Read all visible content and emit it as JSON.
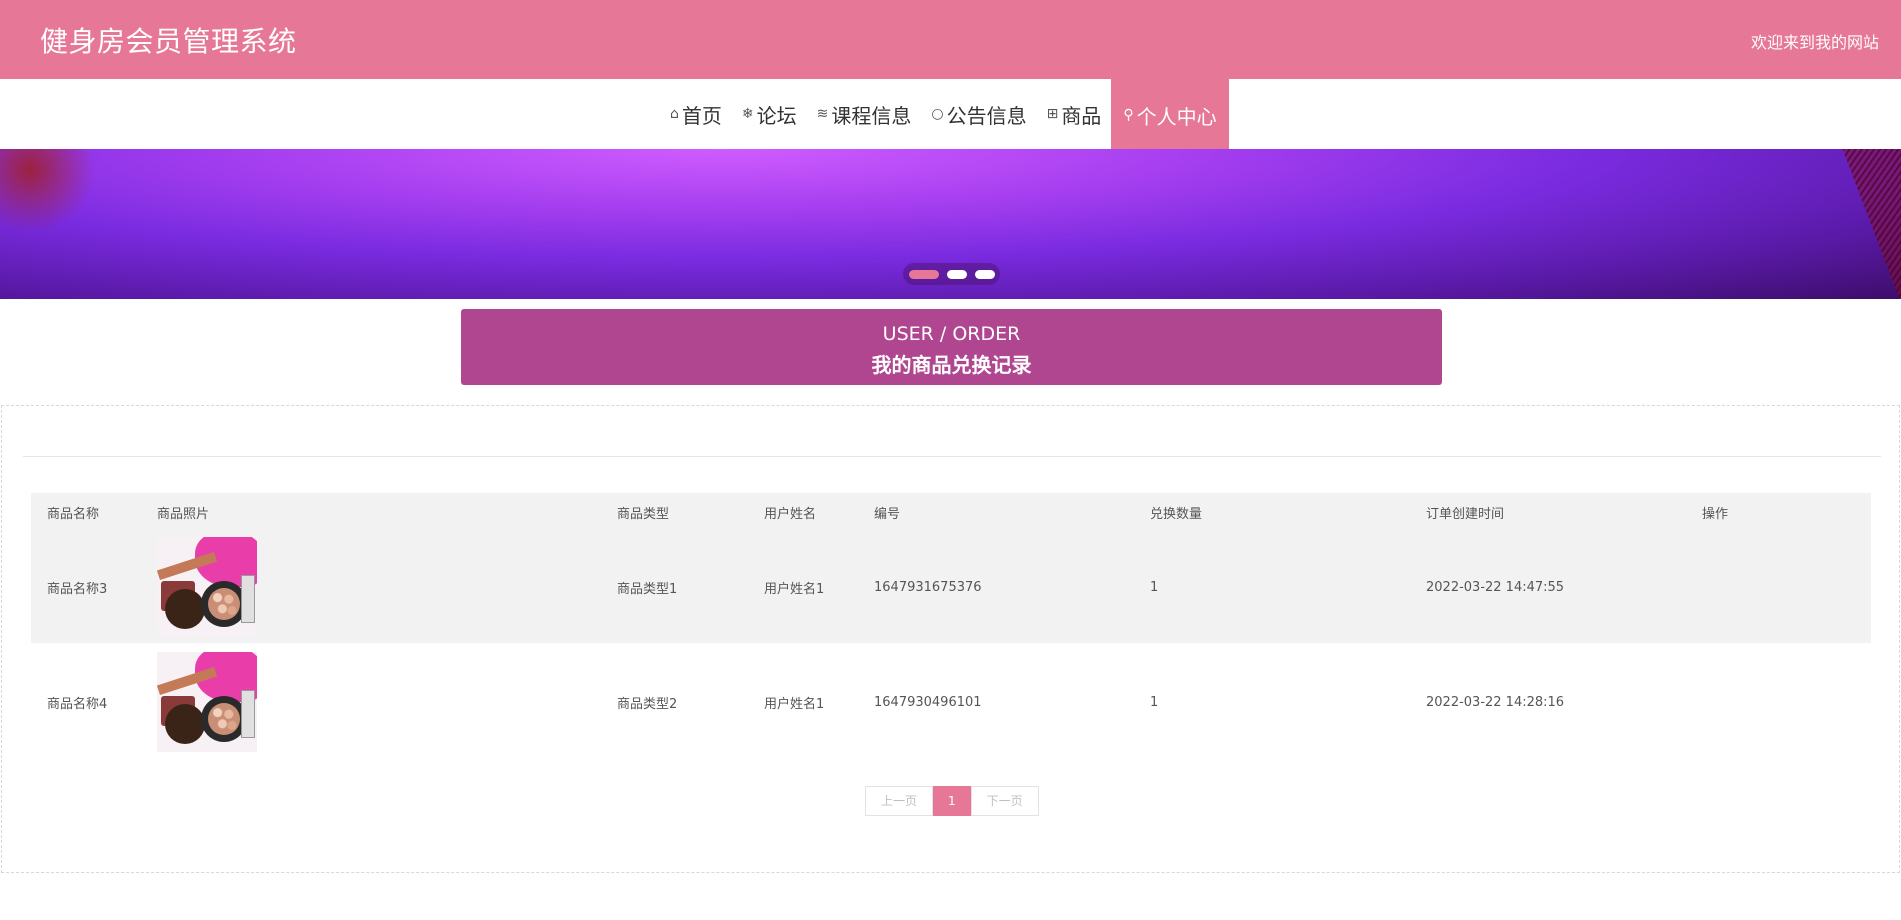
{
  "header": {
    "title": "健身房会员管理系统",
    "welcome": "欢迎来到我的网站"
  },
  "nav": {
    "items": [
      {
        "icon": "home-icon",
        "glyph": "⌂",
        "label": "首页"
      },
      {
        "icon": "snowflake-icon",
        "glyph": "❄",
        "label": "论坛"
      },
      {
        "icon": "layers-icon",
        "glyph": "≋",
        "label": "课程信息"
      },
      {
        "icon": "bubble-icon",
        "glyph": "○",
        "label": "公告信息"
      },
      {
        "icon": "gift-icon",
        "glyph": "⊞",
        "label": "商品"
      },
      {
        "icon": "user-icon",
        "glyph": "⚲",
        "label": "个人中心"
      }
    ],
    "active": "个人中心"
  },
  "banner": {
    "dots": 3,
    "active_dot": 1
  },
  "section": {
    "title_en": "USER / ORDER",
    "title_cn": "我的商品兑换记录"
  },
  "table": {
    "headers": [
      "商品名称",
      "商品照片",
      "商品类型",
      "用户姓名",
      "编号",
      "兑换数量",
      "订单创建时间",
      "操作"
    ],
    "rows": [
      {
        "name": "商品名称3",
        "photo": "cosmetics-photo",
        "type": "商品类型1",
        "user": "用户姓名1",
        "code": "1647931675376",
        "qty": "1",
        "created": "2022-03-22 14:47:55",
        "action": ""
      },
      {
        "name": "商品名称4",
        "photo": "cosmetics-photo",
        "type": "商品类型2",
        "user": "用户姓名1",
        "code": "1647930496101",
        "qty": "1",
        "created": "2022-03-22 14:28:16",
        "action": ""
      }
    ]
  },
  "pager": {
    "prev": "上一页",
    "current": "1",
    "next": "下一页"
  },
  "colors": {
    "accent": "#e77797",
    "section_header": "#b0468f"
  }
}
